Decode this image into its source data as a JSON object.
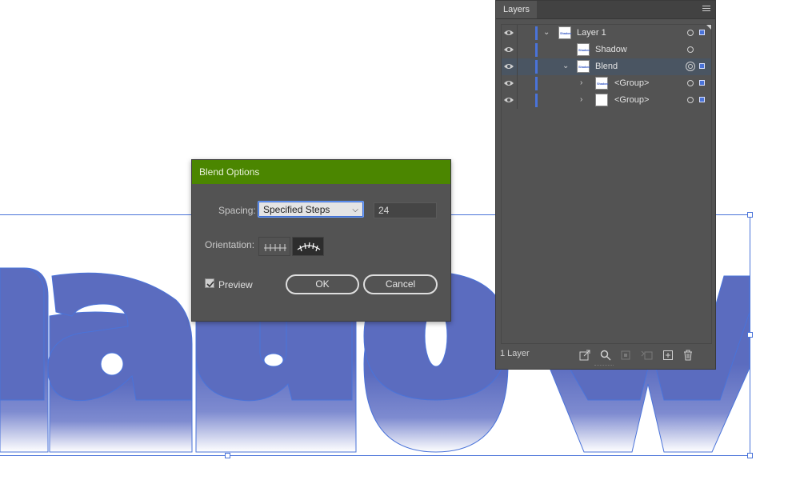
{
  "artwork": {
    "text": "Shadow",
    "fill_color": "#5b6cbf",
    "outline_color": "#4a73d9"
  },
  "blend_dialog": {
    "title": "Blend Options",
    "spacing_label": "Spacing:",
    "spacing_value": "Specified Steps",
    "steps_value": "24",
    "orientation_label": "Orientation:",
    "preview_label": "Preview",
    "preview_checked": true,
    "ok_label": "OK",
    "cancel_label": "Cancel",
    "title_bar_color": "#4b8600"
  },
  "layers_panel": {
    "tab": "Layers",
    "rows": [
      {
        "name": "Layer 1",
        "thumb_text": "Shadow"
      },
      {
        "name": "Shadow",
        "thumb_text": "Shadow"
      },
      {
        "name": "Blend",
        "thumb_text": "Shadow",
        "selected": true
      },
      {
        "name": "<Group>",
        "thumb_text": "Shadow"
      },
      {
        "name": "<Group>",
        "thumb_text": ""
      }
    ],
    "footer_count": "1 Layer",
    "accent_color": "#4a73d9"
  }
}
